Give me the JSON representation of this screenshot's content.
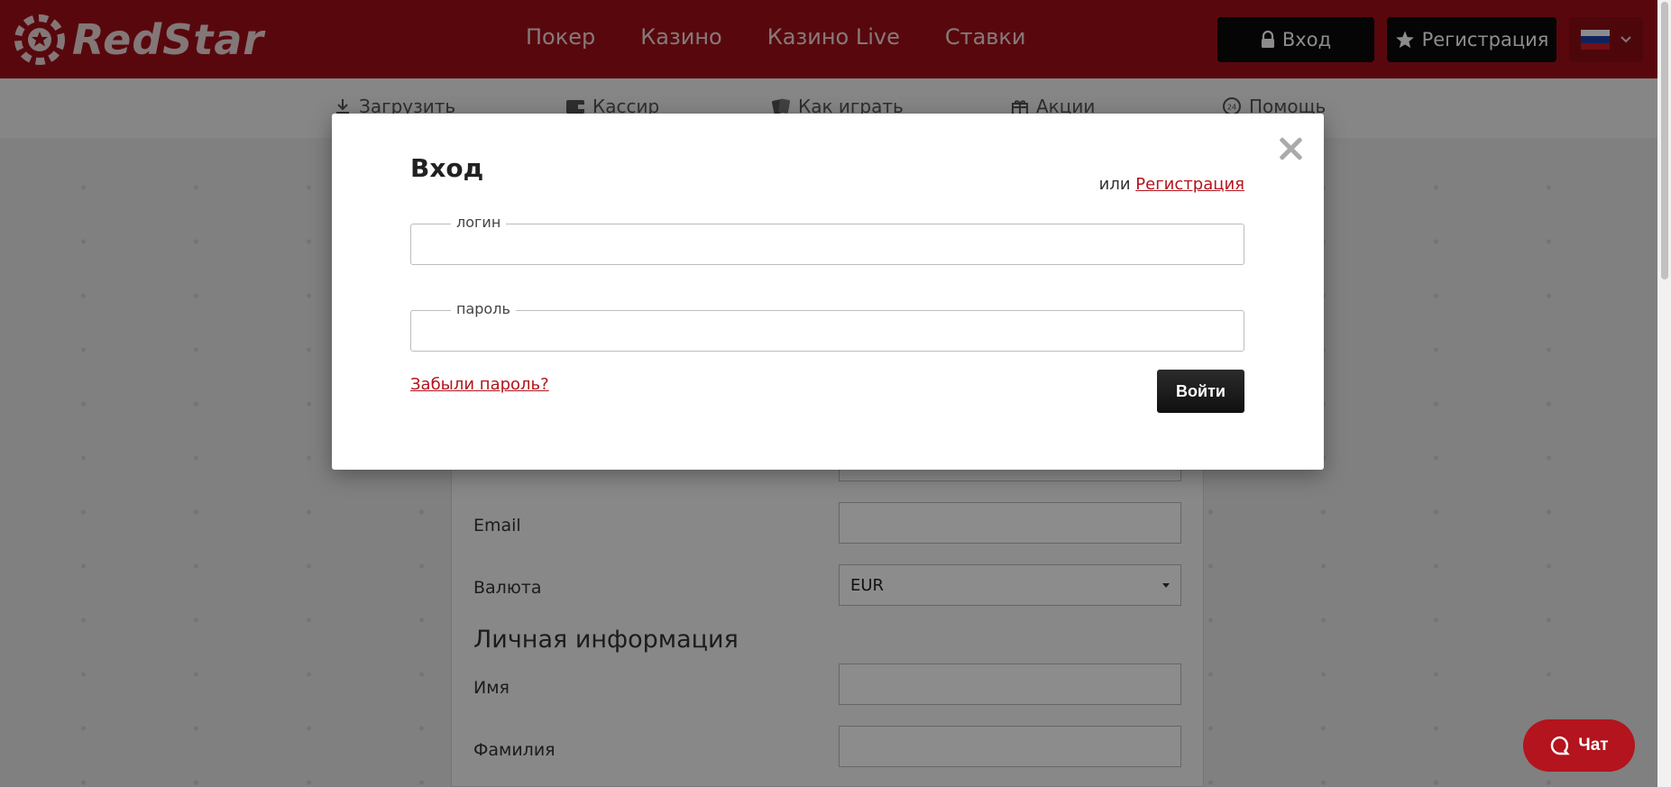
{
  "brand": {
    "name": "RedStar"
  },
  "header": {
    "nav": [
      "Покер",
      "Казино",
      "Казино Live",
      "Ставки"
    ],
    "login_label": "Вход",
    "register_label": "Регистрация",
    "language": "Русский"
  },
  "subnav": {
    "items": [
      {
        "label": "Загрузить",
        "icon": "download-icon"
      },
      {
        "label": "Кассир",
        "icon": "wallet-icon"
      },
      {
        "label": "Как играть",
        "icon": "cards-icon"
      },
      {
        "label": "Акции",
        "icon": "gift-icon"
      },
      {
        "label": "Помощь",
        "icon": "support-24-icon"
      }
    ]
  },
  "registration_form": {
    "email_label": "Email",
    "currency_label": "Валюта",
    "currency_value": "EUR",
    "section_personal": "Личная информация",
    "first_name_label": "Имя",
    "last_name_label": "Фамилия"
  },
  "login_modal": {
    "title": "Вход",
    "or_text": "или",
    "register_link": "Регистрация",
    "login_legend": "логин",
    "password_legend": "пароль",
    "forgot_password": "Забыли пароль?",
    "submit": "Войти"
  },
  "chat": {
    "label": "Чат"
  },
  "colors": {
    "brand_red": "#a10f18",
    "link_red": "#b3141d",
    "dark_button": "#0a0a0a"
  }
}
